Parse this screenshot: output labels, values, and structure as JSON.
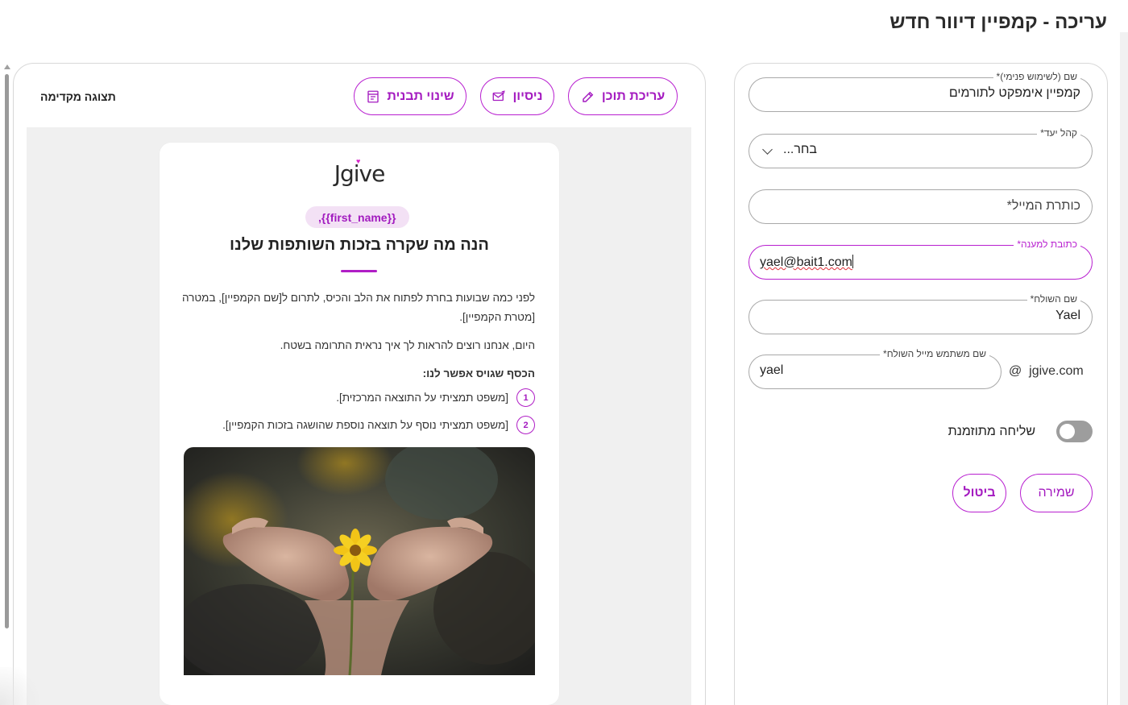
{
  "page": {
    "title": "עריכה - קמפיין דיוור חדש"
  },
  "preview": {
    "title": "תצוגה מקדימה",
    "buttons": {
      "edit_content": "עריכת תוכן",
      "test": "ניסיון",
      "change_template": "שינוי תבנית"
    }
  },
  "email": {
    "logo": "Jgive",
    "greeting_tag": ",{{first_name}}",
    "headline": "הנה מה שקרה בזכות השותפות שלנו",
    "paragraph1": "לפני כמה שבועות בחרת לפתוח את הלב והכיס, לתרום ל[שם הקמפיין], במטרה [מטרת הקמפיין].",
    "paragraph2": "היום, אנחנו רוצים להראות לך איך נראית התרומה בשטח.",
    "list_heading": "הכסף שגויס אפשר לנו:",
    "list": [
      {
        "num": "1",
        "text": "[משפט תמציתי על התוצאה המרכזית]."
      },
      {
        "num": "2",
        "text": "[משפט תמציתי נוסף על תוצאה נוספת שהושגה בזכות הקמפיין]."
      }
    ]
  },
  "form": {
    "internal_name": {
      "label": "שם (לשימוש פנימי)*",
      "value": "קמפיין אימפקט לתורמים"
    },
    "audience": {
      "label": "קהל יעד*",
      "value": "בחר..."
    },
    "subject": {
      "placeholder": "כותרת המייל*"
    },
    "reply_to": {
      "label": "כתובת למענה*",
      "value": "yael@bait1.com"
    },
    "sender_name": {
      "label": "שם השולח*",
      "value": "Yael"
    },
    "sender_user": {
      "label": "שם משתמש מייל השולח*",
      "value": "yael"
    },
    "domain": {
      "at": "@",
      "value": "jgive.com"
    },
    "scheduled": {
      "label": "שליחה מתוזמנת",
      "enabled": false
    },
    "save_label": "שמירה",
    "cancel_label": "ביטול"
  },
  "colors": {
    "accent": "#b81fd0",
    "tag_bg": "#f3e1f5",
    "preview_bg": "#f0f0f0"
  }
}
